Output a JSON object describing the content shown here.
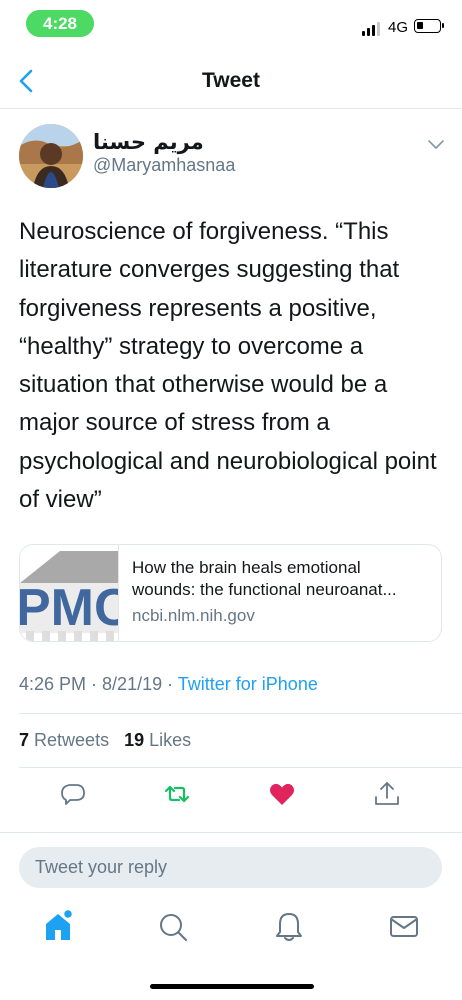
{
  "status_bar": {
    "time": "4:28",
    "network": "4G",
    "battery_level": 0.2,
    "signal_bars": 3,
    "colors": {
      "time_pill": "#4cd964"
    }
  },
  "header": {
    "title": "Tweet",
    "back_icon": "chevron-left-icon",
    "accent": "#1da1f2"
  },
  "tweet": {
    "author": {
      "name": "مريم حسنا",
      "handle": "@Maryamhasnaa"
    },
    "text": "Neuroscience of forgiveness. “This literature converges suggesting that forgiveness represents a positive, “healthy” strategy to overcome a situation that otherwise would be a major source of stress from a psychological and neurobiological point of view”",
    "card": {
      "title_line1": "How the brain heals emotional",
      "title_line2": "wounds: the functional neuroanat...",
      "domain": "ncbi.nlm.nih.gov"
    },
    "meta": {
      "time": "4:26 PM",
      "sep": " · ",
      "date": "8/21/19",
      "source": "Twitter for iPhone"
    },
    "stats": {
      "retweets_count": "7",
      "retweets_label": "Retweets",
      "likes_count": "19",
      "likes_label": "Likes"
    },
    "actions": {
      "reply_icon": "reply-icon",
      "retweet_icon": "retweet-icon",
      "like_icon": "heart-icon",
      "share_icon": "share-icon",
      "colors": {
        "retweeted": "#17bf63",
        "liked": "#e0245e"
      }
    }
  },
  "reply": {
    "placeholder": "Tweet your reply"
  },
  "tabbar": {
    "items": [
      "home-icon",
      "search-icon",
      "notifications-icon",
      "messages-icon"
    ],
    "active_color": "#1da1f2"
  }
}
